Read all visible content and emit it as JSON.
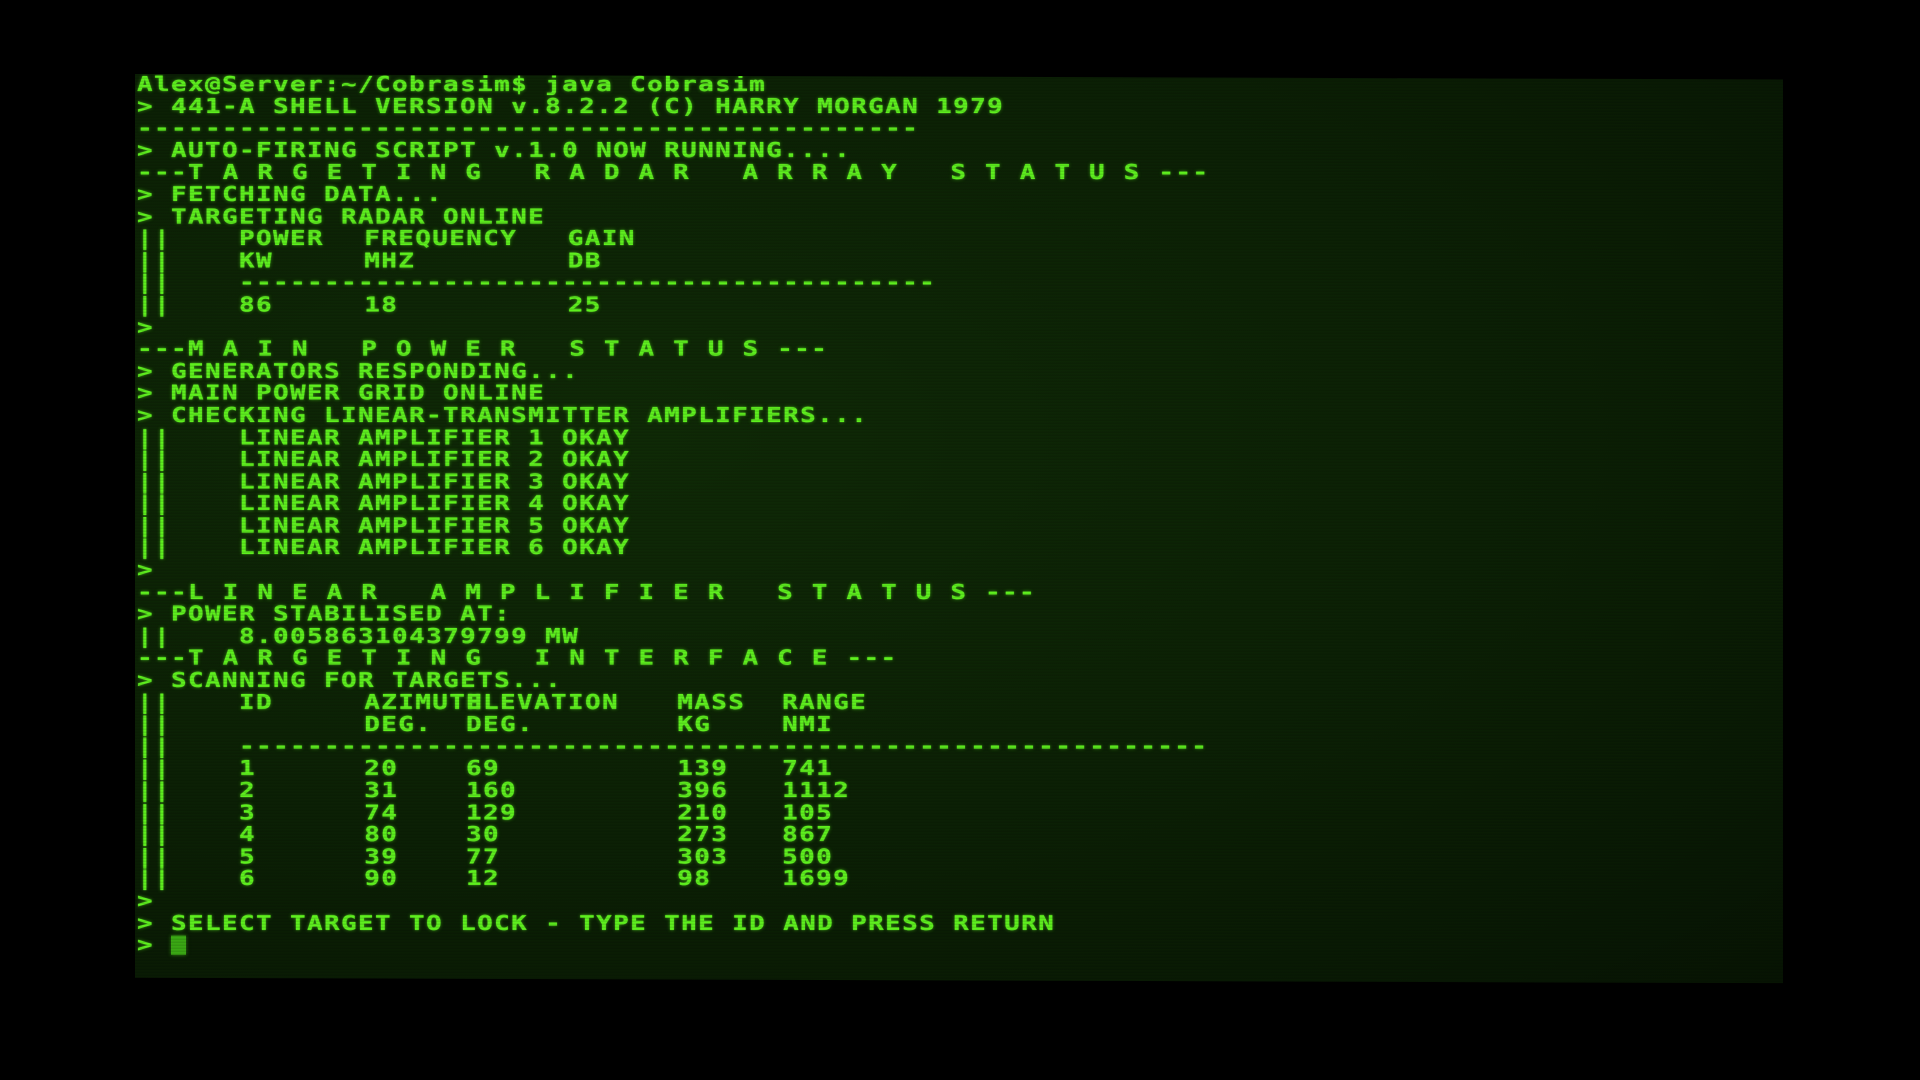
{
  "terminal": {
    "prompt_line": "Alex@Server:~/Cobrasim$ java Cobrasim",
    "shell_version": "> 441-A SHELL VERSION v.8.2.2 (C) HARRY MORGAN 1979",
    "separator": "----------------------------------------------",
    "script_running": "> AUTO-FIRING SCRIPT v.1.0 NOW RUNNING....",
    "prompt_char": ">",
    "row_prefix": "||"
  },
  "radar": {
    "section_title": "TARGETING RADAR ARRAY STATUS",
    "fetching": "> FETCHING DATA...",
    "online": "> TARGETING RADAR ONLINE",
    "headers": [
      "POWER",
      "FREQUENCY",
      "GAIN"
    ],
    "units": [
      "KW",
      "MHZ",
      "DB"
    ],
    "divider": "-----------------------------------------",
    "values": [
      "86",
      "18",
      "25"
    ]
  },
  "main_power": {
    "section_title": "MAIN POWER STATUS",
    "lines": [
      "> GENERATORS RESPONDING...",
      "> MAIN POWER GRID ONLINE",
      "> CHECKING LINEAR-TRANSMITTER AMPLIFIERS..."
    ],
    "amplifiers": [
      "LINEAR AMPLIFIER 1 OKAY",
      "LINEAR AMPLIFIER 2 OKAY",
      "LINEAR AMPLIFIER 3 OKAY",
      "LINEAR AMPLIFIER 4 OKAY",
      "LINEAR AMPLIFIER 5 OKAY",
      "LINEAR AMPLIFIER 6 OKAY"
    ]
  },
  "linear_amplifier": {
    "section_title": "LINEAR AMPLIFIER STATUS",
    "stabilised_label": "> POWER STABILISED AT:",
    "stabilised_value": "8.005863104379799 MW"
  },
  "targeting": {
    "section_title": "TARGETING INTERFACE",
    "scanning": "> SCANNING FOR TARGETS...",
    "headers": [
      "ID",
      "AZIMUTH",
      "ELEVATION",
      "MASS",
      "RANGE"
    ],
    "units": [
      "",
      "DEG.",
      "DEG.",
      "KG",
      "NMI"
    ],
    "divider": "---------------------------------------------------------",
    "rows": [
      [
        "1",
        "20",
        "69",
        "139",
        "741"
      ],
      [
        "2",
        "31",
        "160",
        "396",
        "1112"
      ],
      [
        "3",
        "74",
        "129",
        "210",
        "105"
      ],
      [
        "4",
        "80",
        "30",
        "273",
        "867"
      ],
      [
        "5",
        "39",
        "77",
        "303",
        "500"
      ],
      [
        "6",
        "90",
        "12",
        "98",
        "1699"
      ]
    ],
    "select_prompt": "> SELECT TARGET TO LOCK - TYPE THE ID AND PRESS RETURN",
    "input_value": ""
  }
}
